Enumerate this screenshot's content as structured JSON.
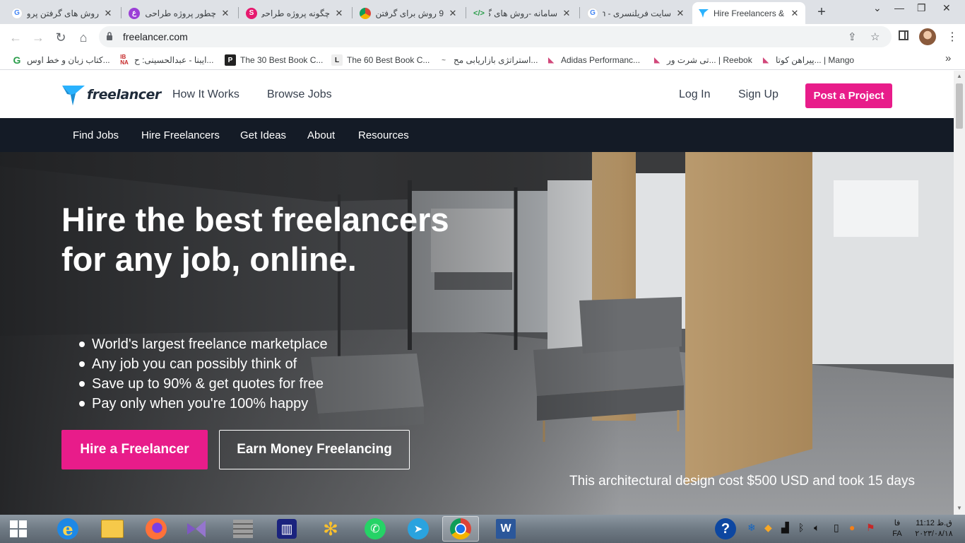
{
  "browser": {
    "tabs": [
      {
        "label": "روش های گرفتن پرو",
        "favicon": "google-g",
        "active": false
      },
      {
        "label": "چطور پروژه طراحی",
        "favicon": "purple-logo",
        "active": false
      },
      {
        "label": "چگونه پروژه طراحی",
        "favicon": "pink-s-logo",
        "active": false
      },
      {
        "label": "9 روش برای گرفتن",
        "favicon": "chrome-logo",
        "active": false
      },
      {
        "label": "سامانه -روش های گ",
        "favicon": "code-logo",
        "active": false
      },
      {
        "label": "سایت فریلنسری - h",
        "favicon": "google-g",
        "active": false
      },
      {
        "label": "Hire Freelancers &",
        "favicon": "freelancer-bird",
        "active": true
      }
    ],
    "url": "freelancer.com",
    "bookmarks": [
      {
        "label": "کتاب زبان و خط اوس...",
        "icon": "green-g"
      },
      {
        "label": "ایبنا - عبدالحسینی: ح...",
        "icon": "ibna"
      },
      {
        "label": "The 30 Best Book C...",
        "icon": "p-logo"
      },
      {
        "label": "The 60 Best Book C...",
        "icon": "l-logo"
      },
      {
        "label": "استراتژی بازاریابی مح...",
        "icon": "dash-logo"
      },
      {
        "label": "Adidas Performanc...",
        "icon": "shoe-logo"
      },
      {
        "label": "تی شرت ور... | Reebok",
        "icon": "shoe-logo"
      },
      {
        "label": "پیراهن کوتا... | Mango",
        "icon": "shoe-logo"
      }
    ]
  },
  "site": {
    "logo_text": "freelancer",
    "header_links": {
      "how_it_works": "How It Works",
      "browse_jobs": "Browse Jobs",
      "log_in": "Log In",
      "sign_up": "Sign Up"
    },
    "post_project": "Post a Project",
    "subnav": [
      "Find Jobs",
      "Hire Freelancers",
      "Get Ideas",
      "About",
      "Resources"
    ],
    "hero": {
      "title": "Hire the best freelancers for any job, online.",
      "bullets": [
        "World's largest freelance marketplace",
        "Any job you can possibly think of",
        "Save up to 90% & get quotes for free",
        "Pay only when you're 100% happy"
      ],
      "hire_button": "Hire a Freelancer",
      "earn_button": "Earn Money Freelancing",
      "caption": "This architectural design cost $500 USD and took 15 days"
    },
    "colors": {
      "accent": "#e81c8a",
      "nav_dark": "#141b26",
      "brand_blue": "#29b2fe"
    }
  },
  "taskbar": {
    "apps": [
      "windows-start",
      "internet-explorer",
      "file-explorer",
      "firefox",
      "visual-studio",
      "app-grid",
      "app-bars",
      "app-puzzle",
      "whatsapp",
      "telegram",
      "chrome",
      "word"
    ],
    "active_app": "chrome",
    "language": "FA",
    "language_short": "فا",
    "time": "11:12 ق.ظ",
    "date": "۲۰۲۳/۰۸/۱۸"
  }
}
